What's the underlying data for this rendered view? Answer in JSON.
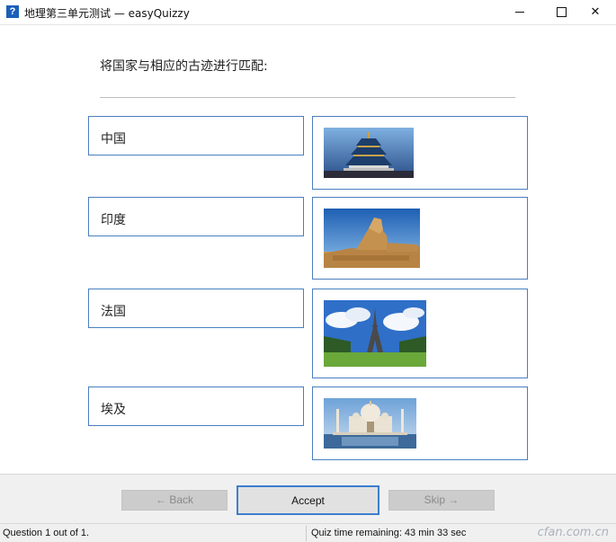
{
  "window": {
    "app_icon": "?",
    "title": "地理第三单元测试 — easyQuizzy",
    "minimize_icon": "minimize-icon",
    "maximize_icon": "maximize-icon",
    "close_icon": "close-icon",
    "close_glyph": "✕"
  },
  "question": {
    "text": "将国家与相应的古迹进行匹配:"
  },
  "pairs": [
    {
      "country": "中国",
      "image": "temple-of-heaven-image"
    },
    {
      "country": "印度",
      "image": "sphinx-image"
    },
    {
      "country": "法国",
      "image": "eiffel-tower-image"
    },
    {
      "country": "埃及",
      "image": "taj-mahal-image"
    }
  ],
  "buttons": {
    "back": "← Back",
    "accept": "Accept",
    "skip": "Skip →"
  },
  "status": {
    "progress": "Question 1 out of 1.",
    "timer": "Quiz time remaining: 43 min 33 sec"
  },
  "watermark": "cfan.com.cn",
  "colors": {
    "accent_border": "#4a7fc1",
    "accept_border": "#3c7fce",
    "panel_bg": "#f0f0f0",
    "app_icon_bg": "#1b5fb8"
  }
}
